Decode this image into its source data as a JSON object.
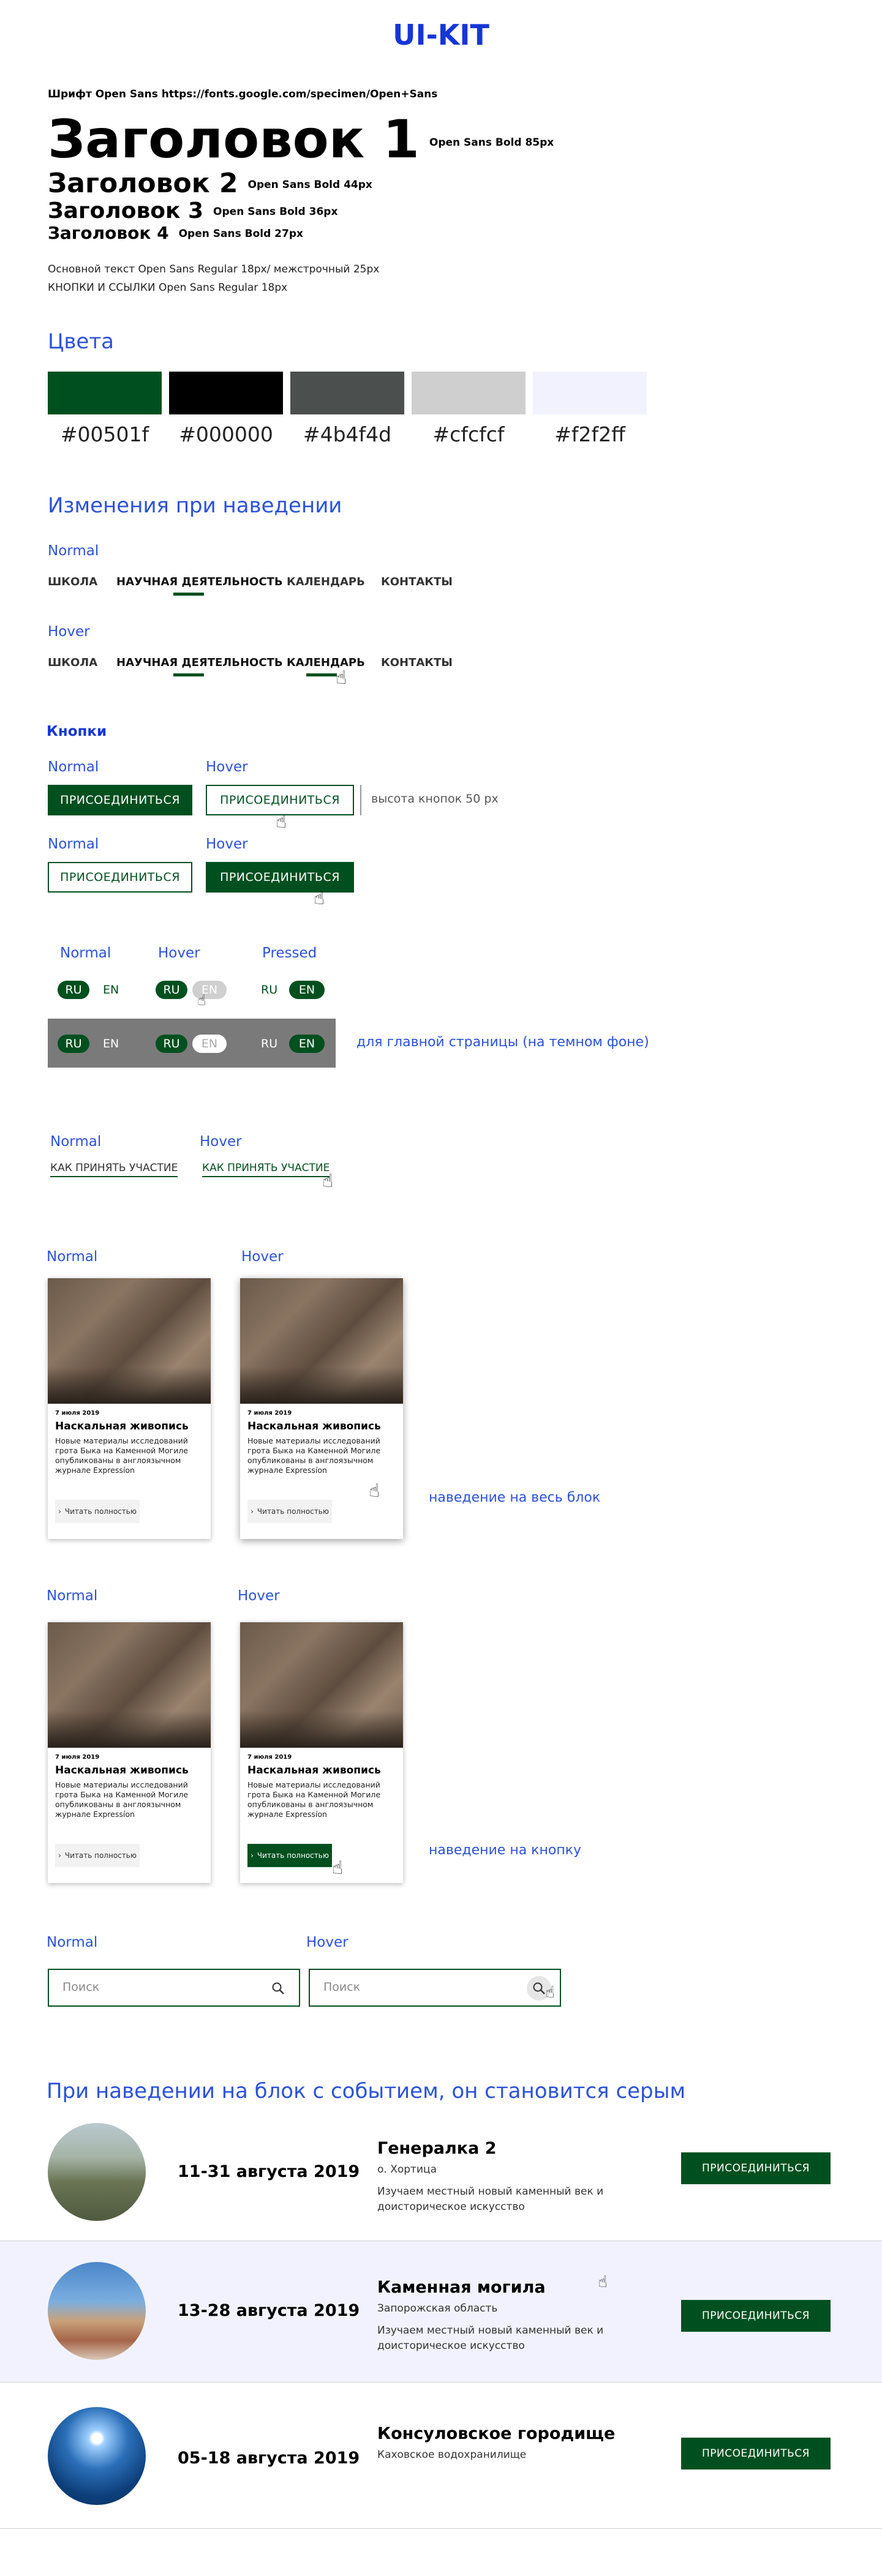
{
  "title": "UI-KIT",
  "typography": {
    "font_note": "Шрифт Open Sans https://fonts.google.com/specimen/Open+Sans",
    "h1": "Заголовок 1",
    "h1_spec": "Open Sans Bold  85px",
    "h2": "Заголовок 2",
    "h2_spec": "Open Sans Bold  44px",
    "h3": "Заголовок 3",
    "h3_spec": "Open Sans Bold 36px",
    "h4": "Заголовок 4",
    "h4_spec": "Open Sans Bold 27px",
    "body_note": "Основной текст Open Sans Regular  18px/ межстрочный 25px",
    "links_note": "КНОПКИ И ССЫЛКИ Open Sans Regular  18px"
  },
  "colors": {
    "heading": "Цвета",
    "swatches": [
      {
        "hex": "#00501f",
        "label": "#00501f"
      },
      {
        "hex": "#000000",
        "label": "#000000"
      },
      {
        "hex": "#4b4f4d",
        "label": "#4b4f4d"
      },
      {
        "hex": "#cfcfcf",
        "label": "#cfcfcf"
      },
      {
        "hex": "#f2f2ff",
        "label": "#f2f2ff"
      }
    ]
  },
  "hover_section": {
    "heading": "Изменения при наведении",
    "normal": "Normal",
    "hover": "Hover",
    "nav_items": [
      "ШКОЛА",
      "НАУЧНАЯ ДЕЯТЕЛЬНОСТЬ",
      "КАЛЕНДАРЬ",
      "КОНТАКТЫ"
    ]
  },
  "buttons": {
    "heading": "Кнопки",
    "normal": "Normal",
    "hover": "Hover",
    "pressed": "Pressed",
    "join": "ПРИСОЕДИНИТЬСЯ",
    "height_note": "высота кнопок 50 px",
    "lang_ru": "RU",
    "lang_en": "EN",
    "dark_note": "для главной страницы (на темном фоне)",
    "participate": "КАК ПРИНЯТЬ УЧАСТИЕ"
  },
  "cards": {
    "normal": "Normal",
    "hover": "Hover",
    "date": "7 июля 2019",
    "title": "Наскальная живопись",
    "text": "Новые материалы исследований грота Быка на Каменной Могиле опубликованы в англоязычном журнале Expressíon",
    "read_more": "Читать полностью",
    "note_block": "наведение на весь блок",
    "note_button": "наведение на кнопку"
  },
  "search": {
    "normal": "Normal",
    "hover": "Hover",
    "placeholder": "Поиск"
  },
  "events": {
    "heading": "При наведении на блок с событием, он становится серым",
    "join": "ПРИСОЕДИНИТЬСЯ",
    "hover_bg": "#f2f2ff",
    "items": [
      {
        "date": "11-31 августа 2019",
        "name": "Генералка 2",
        "place": "о. Хортица",
        "desc": "Изучаем местный новый каменный век и доисторическое искусство"
      },
      {
        "date": "13-28 августа 2019",
        "name": "Каменная могила",
        "place": "Запорожская область",
        "desc": "Изучаем местный новый каменный век и доисторическое искусство"
      },
      {
        "date": "05-18 августа 2019",
        "name": "Консуловское городище",
        "place": "Каховское водохранилище",
        "desc": ""
      }
    ]
  }
}
